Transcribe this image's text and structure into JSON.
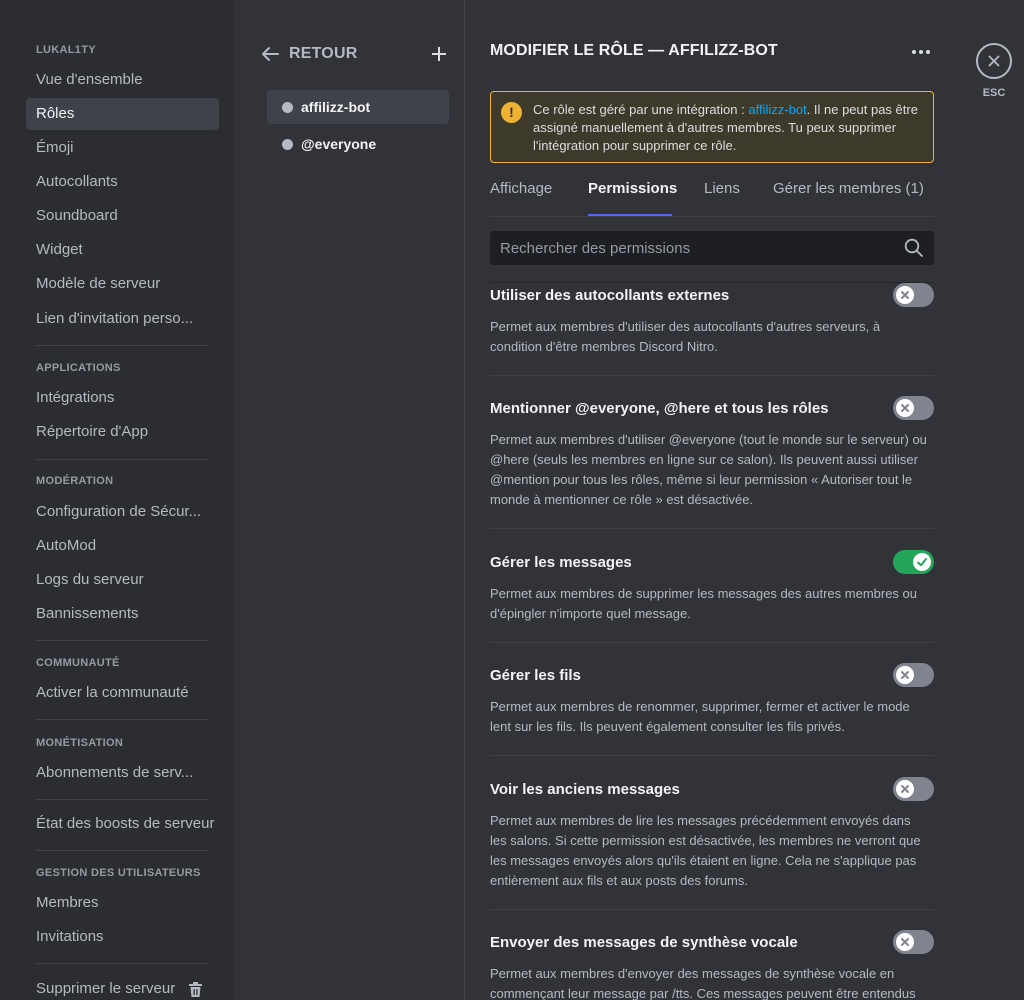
{
  "sidebar": {
    "server_header": "LUKAL1TY",
    "general": [
      "Vue d'ensemble",
      "Rôles",
      "Émoji",
      "Autocollants",
      "Soundboard",
      "Widget",
      "Modèle de serveur",
      "Lien d'invitation perso..."
    ],
    "applications_header": "APPLICATIONS",
    "applications": [
      "Intégrations",
      "Répertoire d'App"
    ],
    "moderation_header": "MODÉRATION",
    "moderation": [
      "Configuration de Sécur...",
      "AutoMod",
      "Logs du serveur",
      "Bannissements"
    ],
    "community_header": "COMMUNAUTÉ",
    "community": [
      "Activer la communauté"
    ],
    "monetization_header": "MONÉTISATION",
    "monetization": [
      "Abonnements de serv..."
    ],
    "boost_status": "État des boosts de serveur",
    "user_management_header": "GESTION DES UTILISATEURS",
    "user_management": [
      "Membres",
      "Invitations"
    ],
    "delete_server": "Supprimer le serveur"
  },
  "roles_panel": {
    "back_label": "RETOUR",
    "roles": [
      "affilizz-bot",
      "@everyone"
    ]
  },
  "main": {
    "title": "MODIFIER LE RÔLE — AFFILIZZ-BOT",
    "notice": {
      "before": "Ce rôle est géré par une intégration : ",
      "link": "affilizz-bot",
      "after": ". Il ne peut pas être assigné manuellement à d'autres membres. Tu peux supprimer l'intégration pour supprimer ce rôle."
    },
    "tabs": [
      "Affichage",
      "Permissions",
      "Liens",
      "Gérer les membres (1)"
    ],
    "active_tab": "Permissions",
    "search_placeholder": "Rechercher des permissions",
    "permissions": [
      {
        "name": "Utiliser des autocollants externes",
        "description": "Permet aux membres d'utiliser des autocollants d'autres serveurs, à condition d'être membres Discord Nitro.",
        "enabled": false
      },
      {
        "name": "Mentionner @everyone, @here et tous les rôles",
        "description": "Permet aux membres d'utiliser @everyone (tout le monde sur le serveur) ou @here (seuls les membres en ligne sur ce salon). Ils peuvent aussi utiliser @mention pour tous les rôles, même si leur permission « Autoriser tout le monde à mentionner ce rôle » est désactivée.",
        "enabled": false
      },
      {
        "name": "Gérer les messages",
        "description": "Permet aux membres de supprimer les messages des autres membres ou d'épingler n'importe quel message.",
        "enabled": true
      },
      {
        "name": "Gérer les fils",
        "description": "Permet aux membres de renommer, supprimer, fermer et activer le mode lent sur les fils. Ils peuvent également consulter les fils privés.",
        "enabled": false
      },
      {
        "name": "Voir les anciens messages",
        "description": "Permet aux membres de lire les messages précédemment envoyés dans les salons. Si cette permission est désactivée, les membres ne verront que les messages envoyés alors qu'ils étaient en ligne. Cela ne s'applique pas entièrement aux fils et aux posts des forums.",
        "enabled": false
      },
      {
        "name": "Envoyer des messages de synthèse vocale",
        "description": "Permet aux membres d'envoyer des messages de synthèse vocale en commençant leur message par /tts. Ces messages peuvent être entendus",
        "enabled": false
      }
    ]
  },
  "close": {
    "label": "ESC"
  },
  "colors": {
    "accent": "#5865f2",
    "toggle_on": "#23a55a",
    "toggle_off": "#80848e",
    "warning": "#f0b232",
    "link": "#00a8fc"
  }
}
